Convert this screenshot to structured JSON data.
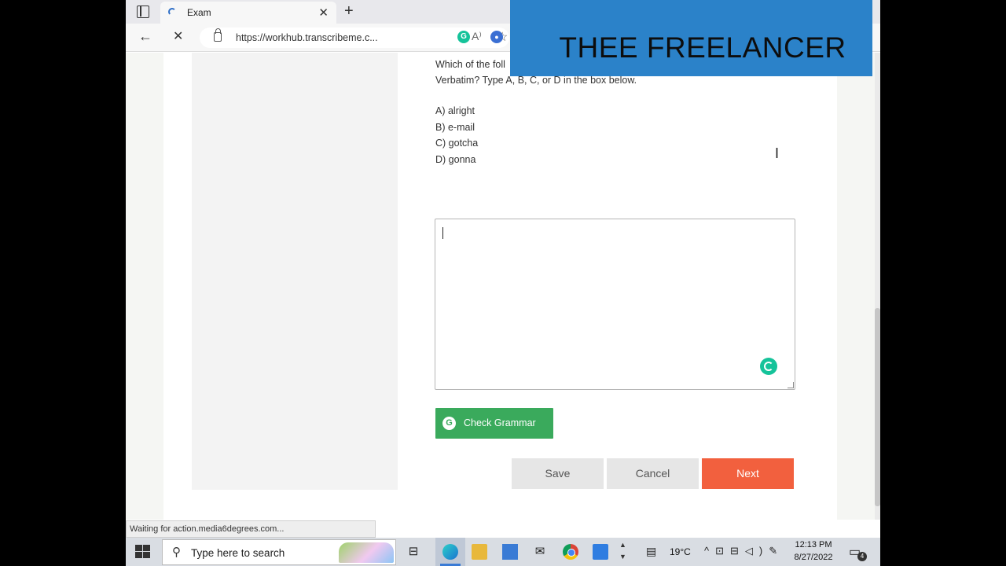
{
  "browser": {
    "tab_title": "Exam",
    "url": "https://workhub.transcribeme.c...",
    "status_text": "Waiting for action.media6degrees.com..."
  },
  "banner": {
    "text": "THEE FREELANCER",
    "color": "#2b82c9"
  },
  "exam": {
    "question_line1": "Which of the foll",
    "question_line2": "Verbatim? Type A, B, C, or D in the box below.",
    "options": [
      "A) alright",
      "B) e-mail",
      "C) gotcha",
      "D) gonna"
    ],
    "answer_value": "",
    "check_grammar_label": "Check Grammar",
    "save_label": "Save",
    "cancel_label": "Cancel",
    "next_label": "Next"
  },
  "colors": {
    "grammar_green": "#3aaa5c",
    "next_orange": "#f2603e",
    "secondary_gray": "#e6e6e6"
  },
  "icons": [
    "tab-actions-icon",
    "loading-icon",
    "close-icon",
    "plus-icon",
    "back-arrow-icon",
    "stop-icon",
    "lock-icon",
    "read-aloud-icon",
    "favorite-star-icon",
    "grammarly-extension-icon",
    "extension-icon",
    "windows-start-icon",
    "search-icon",
    "task-view-icon",
    "edge-icon",
    "folder-icon",
    "store-icon",
    "mail-icon",
    "chrome-icon",
    "remote-desktop-icon",
    "chevron-icon",
    "weather-icon",
    "network-icon",
    "volume-icon",
    "pen-icon",
    "notification-icon"
  ],
  "taskbar": {
    "search_placeholder": "Type here to search",
    "temperature": "19°C",
    "time": "12:13 PM",
    "date": "8/27/2022",
    "notification_count": "4"
  }
}
